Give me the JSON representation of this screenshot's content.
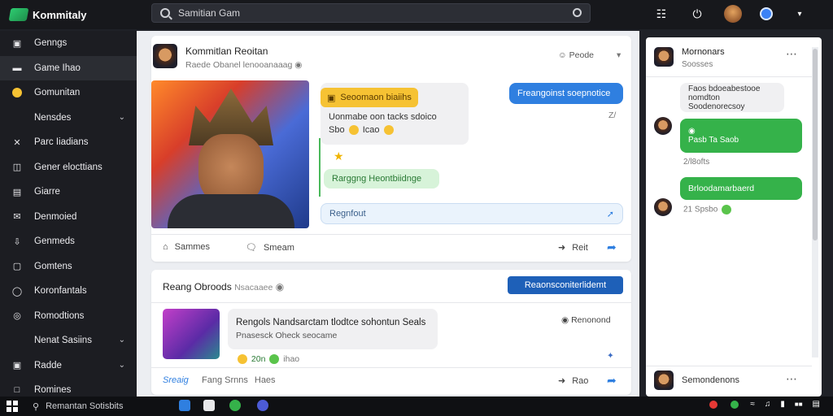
{
  "app": {
    "title": "Kommitaly"
  },
  "search": {
    "value": "Samitian Gam"
  },
  "sidebar": {
    "items": [
      {
        "label": "Genngs",
        "icon": "grid-icon"
      },
      {
        "label": "Game Ihao",
        "icon": "list-icon"
      },
      {
        "label": "Gomunitan",
        "icon": "emoji-icon"
      },
      {
        "label": "Nensdes",
        "icon": ""
      },
      {
        "label": "Parc Iiadians",
        "icon": "close-icon"
      },
      {
        "label": "Gener elocttians",
        "icon": "chat-icon"
      },
      {
        "label": "Giarre",
        "icon": "image-icon"
      },
      {
        "label": "Denmoied",
        "icon": "mail-icon"
      },
      {
        "label": "Genmeds",
        "icon": "download-icon"
      },
      {
        "label": "Gomtens",
        "icon": "monitor-icon"
      },
      {
        "label": "Koronfantals",
        "icon": "circle-icon"
      },
      {
        "label": "Romodtions",
        "icon": "target-icon"
      },
      {
        "label": "Nenat Sasiins",
        "icon": ""
      },
      {
        "label": "Radde",
        "icon": "folder-icon"
      },
      {
        "label": "Romines",
        "icon": "square-icon"
      }
    ]
  },
  "post1": {
    "author": "Kommitlan Reoitan",
    "meta": "Raede Obanel lenooanaaag",
    "people_label": "Peode",
    "bubble_tag": "Seoomaon biaiihs",
    "bubble_text1": "Uonmabe oon tacks sdoico",
    "bubble_text1b": "Sbo",
    "bubble_text1c": "Icao",
    "bubble_green": "Rarggng Heontbiidnge",
    "reply_blue": "Freangoinst soepnotice",
    "reply_meta": "Z/",
    "input_text": "Regnfout",
    "action_share": "Sammes",
    "action_comment": "Smeam",
    "action_right": "Reit"
  },
  "post2": {
    "title": "Reang Obroods",
    "title_meta": "Nsacaaee",
    "pill": "Reaonsconiterlidemt",
    "bubble_title": "Rengols Nandsarctam tlodtce sohontun Seals",
    "bubble_sub": "Pnasesck Oheck seocame",
    "reactions": "20n",
    "reactions2": "ihao",
    "side_label": "Renonond",
    "footer_left": "Sreaig",
    "footer_mid": "Fang Srnns",
    "footer_mid2": "Haes",
    "footer_right": "Rao"
  },
  "right_panel": {
    "title": "Mornonars",
    "subtitle": "Soosses",
    "msg1": "Faos bdoeabestooe nomdton",
    "msg1b": "Soodenorecsoy",
    "msg2": "Pasb Ta Saob",
    "msg2_meta": "2/l8ofts",
    "msg3": "Brloodamarbaerd",
    "msg3_meta": "21 Spsbo",
    "footer": "Semondenons"
  },
  "taskbar": {
    "search": "Remantan Sotisbits"
  },
  "colors": {
    "accent_blue": "#2f7fe0",
    "accent_green": "#35b24a",
    "pill_blue": "#1e60b8"
  }
}
